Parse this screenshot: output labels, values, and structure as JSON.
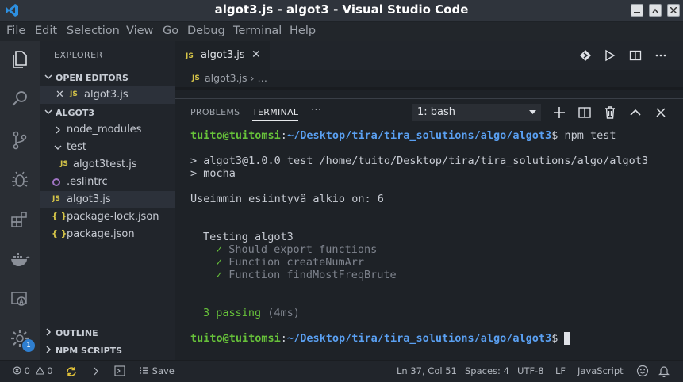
{
  "window": {
    "title": "algot3.js - algot3 - Visual Studio Code"
  },
  "menu": [
    "File",
    "Edit",
    "Selection",
    "View",
    "Go",
    "Debug",
    "Terminal",
    "Help"
  ],
  "activity": {
    "badge": "1"
  },
  "sidebar": {
    "header": "EXPLORER",
    "open_editors": {
      "label": "OPEN EDITORS",
      "files": [
        {
          "icon": "JS",
          "name": "algot3.js"
        }
      ]
    },
    "project": {
      "label": "ALGOT3",
      "items": [
        {
          "type": "folder",
          "name": "node_modules"
        },
        {
          "type": "folder",
          "name": "test"
        },
        {
          "type": "file",
          "icon": "JS",
          "name": "algot3test.js"
        },
        {
          "type": "file",
          "icon": "",
          "name": ".eslintrc"
        },
        {
          "type": "file",
          "icon": "JS",
          "name": "algot3.js"
        },
        {
          "type": "file",
          "icon": "{ }",
          "name": "package-lock.json"
        },
        {
          "type": "file",
          "icon": "{ }",
          "name": "package.json"
        }
      ]
    },
    "outline": "OUTLINE",
    "npm_scripts": "NPM SCRIPTS"
  },
  "editor": {
    "tab": {
      "icon": "JS",
      "label": "algot3.js",
      "close": "✕"
    },
    "breadcrumb": "algot3.js › …"
  },
  "panel": {
    "tabs": [
      "PROBLEMS",
      "TERMINAL"
    ],
    "more": "···",
    "terminal_select": "1: bash",
    "terminal": {
      "prompt_user": "tuito@tuitomsi",
      "prompt_sep": ":",
      "prompt_path": "~/Desktop/tira/tira_solutions/algo/algot3",
      "prompt_end": "$",
      "command": " npm test",
      "lines": [
        "> algot3@1.0.0 test /home/tuito/Desktop/tira/tira_solutions/algo/algot3",
        "> mocha",
        "Useimmin esiintyvä alkio on: 6",
        "Testing algot3"
      ],
      "tests": [
        "Should export functions",
        "Function createNumArr",
        "Function findMostFreqBrute"
      ],
      "check": "✓",
      "passing": "3 passing",
      "duration": "(4ms)"
    }
  },
  "status": {
    "errors": "0",
    "warnings": "0",
    "save": "Save",
    "position": "Ln 37, Col 51",
    "spaces": "Spaces: 4",
    "encoding": "UTF-8",
    "eol": "LF",
    "language": "JavaScript"
  }
}
